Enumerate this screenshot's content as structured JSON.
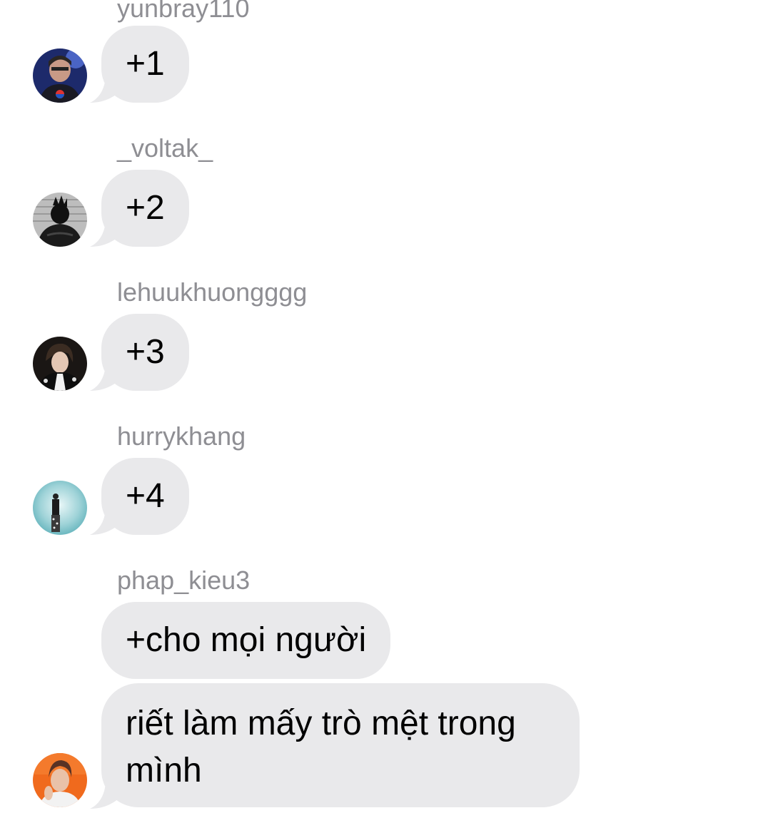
{
  "messages": [
    {
      "sender": "yunbray110",
      "text": "+1",
      "avatar_icon": "user-avatar-yunbray110"
    },
    {
      "sender": "_voltak_",
      "text": "+2",
      "avatar_icon": "user-avatar-voltak"
    },
    {
      "sender": "lehuukhuongggg",
      "text": "+3",
      "avatar_icon": "user-avatar-lehuukhuongggg"
    },
    {
      "sender": "hurrykhang",
      "text": "+4",
      "avatar_icon": "user-avatar-hurrykhang"
    },
    {
      "sender": "phap_kieu3",
      "texts": [
        "+cho mọi người",
        "riết làm mấy trò mệt trong mình"
      ],
      "avatar_icon": "user-avatar-phap-kieu3"
    }
  ],
  "colors": {
    "bubble_bg": "#e9e9eb",
    "sender_text": "#8e8e93",
    "message_text": "#000000",
    "background": "#ffffff"
  }
}
